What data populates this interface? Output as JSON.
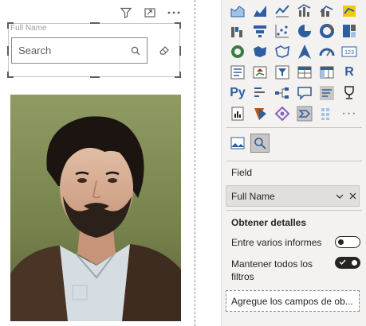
{
  "slicer": {
    "title": "Full Name",
    "search_placeholder": "Search"
  },
  "visual_header": {
    "icons": [
      "filter-icon",
      "focus-mode-icon",
      "more-options-icon"
    ]
  },
  "photo": {
    "description_icon": "person-photo"
  },
  "viz_pane": {
    "icons": [
      "stacked-area-chart",
      "area-chart",
      "line-chart",
      "line-clustered-column-chart",
      "line-stacked-column-chart",
      "ribbon-chart",
      "waterfall-chart",
      "funnel-chart",
      "scatter-chart",
      "pie-chart",
      "donut-chart",
      "treemap",
      "map",
      "filled-map",
      "shape-map",
      "azure-map",
      "gauge",
      "card",
      "multi-row-card",
      "kpi",
      "slicer",
      "table",
      "matrix",
      "r-visual",
      "python-visual",
      "key-influencers",
      "decomposition-tree",
      "qa-visual",
      "smart-narrative",
      "goals",
      "paginated-report",
      "power-apps",
      "power-automate",
      "custom-visual-a",
      "custom-visual-b",
      "more"
    ],
    "text_icons": {
      "r_visual": "R",
      "python_visual": "Py",
      "more": "···"
    },
    "format_buttons": [
      "format-visual-icon",
      "analytics-icon"
    ]
  },
  "field_section": {
    "label": "Field",
    "field_value": "Full Name"
  },
  "drillthrough": {
    "title": "Obtener detalles",
    "cross_report_label": "Entre varios informes",
    "cross_report_on": false,
    "keep_filters_label_line1": "Mantener todos los",
    "keep_filters_label_line2": "filtros",
    "keep_filters_on": true,
    "drop_placeholder": "Agregue los campos de ob..."
  },
  "colors": {
    "accent_blue": "#2f5e9e",
    "toggle_dark": "#252423",
    "panel_bg": "#f3f2f1"
  }
}
